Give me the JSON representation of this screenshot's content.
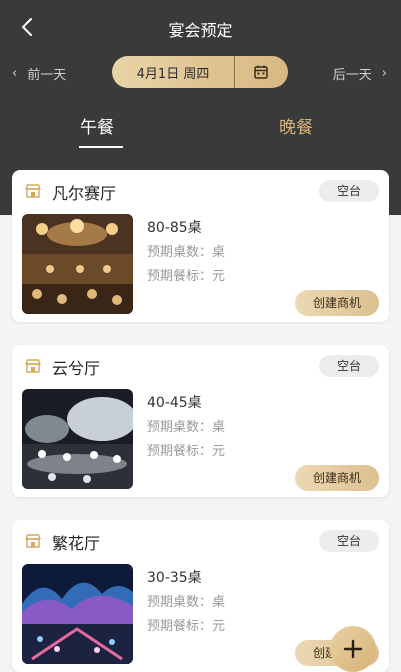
{
  "header": {
    "title": "宴会预定",
    "prev_day": "前一天",
    "next_day": "后一天",
    "date": "4月1日 周四",
    "tabs": {
      "lunch": "午餐",
      "dinner": "晚餐"
    },
    "active_tab": "午餐"
  },
  "colors": {
    "header_bg": "#3a3a3a",
    "accent_gold": "#d8b881",
    "active_tab": "#ffffff",
    "inactive_tab": "#d4b47c"
  },
  "halls": [
    {
      "name": "凡尔赛厅",
      "status": "空台",
      "tables": "80-85桌",
      "expected_tables": "预期桌数：桌",
      "expected_price": "预期餐标：元",
      "action": "创建商机"
    },
    {
      "name": "云兮厅",
      "status": "空台",
      "tables": "40-45桌",
      "expected_tables": "预期桌数：桌",
      "expected_price": "预期餐标：元",
      "action": "创建商机"
    },
    {
      "name": "繁花厅",
      "status": "空台",
      "tables": "30-35桌",
      "expected_tables": "预期桌数：桌",
      "expected_price": "预期餐标：元",
      "action": "创建商机"
    }
  ],
  "icons": {
    "back": "chevron-left-icon",
    "calendar": "calendar-icon",
    "hall": "hall-icon",
    "add": "plus-icon"
  }
}
